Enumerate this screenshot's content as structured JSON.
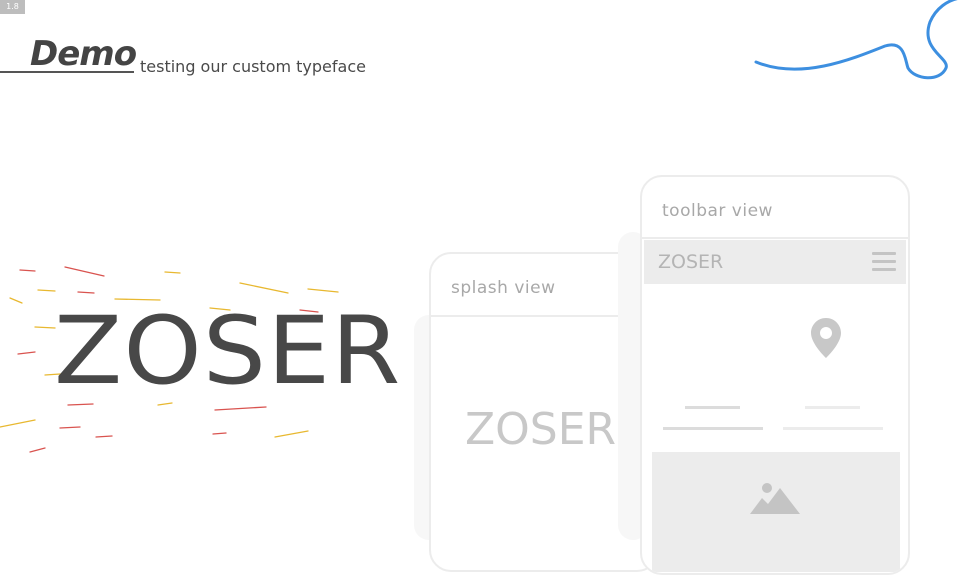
{
  "slide": {
    "number": "1.8"
  },
  "header": {
    "title": "Demo",
    "subtitle": "testing our custom typeface"
  },
  "hero": {
    "logo_text": "ZOSER"
  },
  "splash_phone": {
    "title": "splash view",
    "logo_text": "ZOSER"
  },
  "toolbar_phone": {
    "title": "toolbar view",
    "toolbar_logo": "ZOSER",
    "icons": [
      "menu-icon",
      "location-pin-icon",
      "image-icon"
    ]
  },
  "colors": {
    "accent_blue": "#3d8fe0",
    "streak_red": "#d9534f",
    "streak_yellow": "#e8b830",
    "logo_dark": "#484848"
  }
}
